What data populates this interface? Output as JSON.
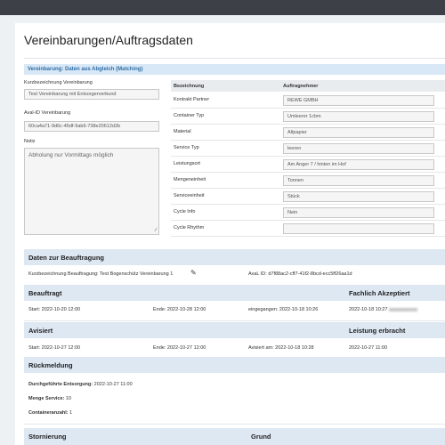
{
  "title": "Vereinbarungen/Auftragsdaten",
  "matching": {
    "header": "Vereinbarung: Daten aus Abgleich (Matching)",
    "kurz_label": "Kurzbezeichnung Vereinbarung",
    "kurz_value": "Test Vereinbarung mit Entsorgerverbund",
    "aval_label": "Aval-ID Vereinbarung",
    "aval_value": "60ca4a71-9d6c-45df-9ab6-738e20612d2b",
    "notiz_label": "Notiz",
    "notiz_value": "Abholung nur Vormittags möglich"
  },
  "table": {
    "col1": "Bezeichnung",
    "col2": "Auftragnehmer",
    "rows": [
      {
        "key": "Kontrakt Partner",
        "value": "REWE GMBH"
      },
      {
        "key": "Container Typ",
        "value": "Umleerer 1cbm"
      },
      {
        "key": "Material",
        "value": "Altpapier"
      },
      {
        "key": "Service Typ",
        "value": "leeren"
      },
      {
        "key": "Leistungsort",
        "value": "Am Anger 7 / hinten im Hof"
      },
      {
        "key": "Mengeneinheit",
        "value": "Tonnen"
      },
      {
        "key": "Serviceeinheit",
        "value": "Stück"
      },
      {
        "key": "Cycle Info",
        "value": "Nein"
      },
      {
        "key": "Cycle Rhythm",
        "value": ""
      }
    ]
  },
  "beauftragung": {
    "header": "Daten zur Beauftragung",
    "kurz_label": "Kurzbezeichnung Beauftragung:",
    "kurz_value": "Test Bogenschütz Vereinbarung 1",
    "aval_label": "AvaL ID:",
    "aval_value": "d7f88ac2-cff7-41f2-8bcd-ecc5ff26aa1d",
    "edit_icon": "edit-icon"
  },
  "beauftragt": {
    "header": "Beauftragt",
    "header_right": "Fachlich Akzeptiert",
    "start": "Start: 2022-10-20 12:00",
    "ende": "Ende: 2022-10-28 12:00",
    "eingegangen": "eingegangen: 2022-10-18 10:26",
    "akzeptiert": "2022-10-18 10:27"
  },
  "avisiert": {
    "header": "Avisiert",
    "header_right": "Leistung erbracht",
    "start": "Start: 2022-10-27 12:00",
    "ende": "Ende: 2022-10-27 12:00",
    "avisiert_am": "Avisiert am: 2022-10-18 10:28",
    "erbracht": "2022-10-27 11:00"
  },
  "rueckmeldung": {
    "header": "Rückmeldung",
    "entsorgung_label": "Durchgeführte Entsorgung:",
    "entsorgung_value": "2022-10-27 11:00",
    "menge_label": "Menge Service:",
    "menge_value": "10",
    "container_label": "Containeranzahl:",
    "container_value": "1"
  },
  "stornierung": {
    "header": "Stornierung",
    "grund": "Grund"
  }
}
